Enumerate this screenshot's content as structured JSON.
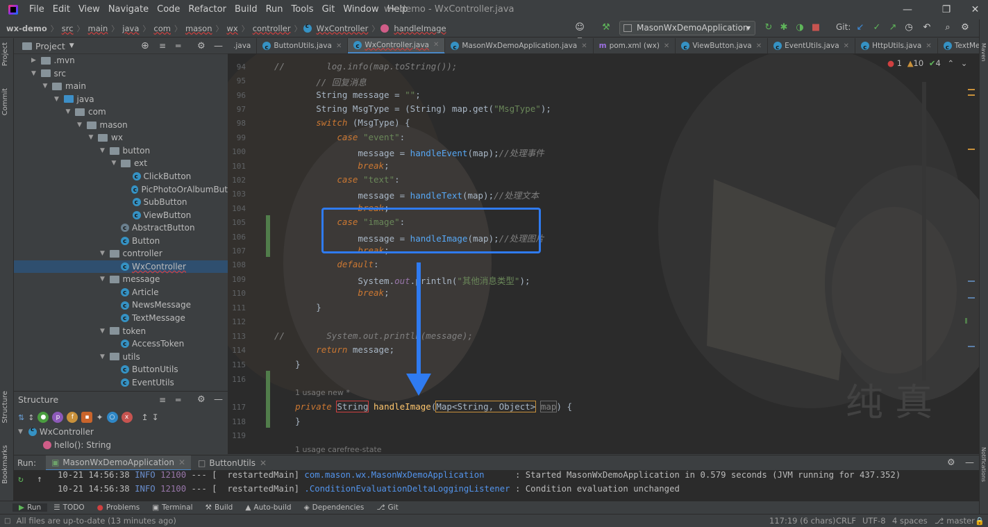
{
  "menu": [
    "File",
    "Edit",
    "View",
    "Navigate",
    "Code",
    "Refactor",
    "Build",
    "Run",
    "Tools",
    "Git",
    "Window",
    "Help"
  ],
  "window_title": "wx-demo - WxController.java",
  "breadcrumbs": [
    "wx-demo",
    "src",
    "main",
    "java",
    "com",
    "mason",
    "wx",
    "controller",
    "WxController",
    "handleImage"
  ],
  "toolbar": {
    "run_config": "MasonWxDemoApplication",
    "git_label": "Git:"
  },
  "project_panel": {
    "title": "Project"
  },
  "tree": [
    {
      "label": ".mvn",
      "depth": 1,
      "open": false
    },
    {
      "label": "src",
      "depth": 1,
      "open": true
    },
    {
      "label": "main",
      "depth": 2,
      "open": true
    },
    {
      "label": "java",
      "depth": 3,
      "open": true
    },
    {
      "label": "com",
      "depth": 4,
      "open": true
    },
    {
      "label": "mason",
      "depth": 5,
      "open": true
    },
    {
      "label": "wx",
      "depth": 6,
      "open": true
    },
    {
      "label": "button",
      "depth": 7,
      "open": true
    },
    {
      "label": "ext",
      "depth": 8,
      "open": true
    },
    {
      "label": "ClickButton",
      "depth": 9,
      "type": "class"
    },
    {
      "label": "PicPhotoOrAlbumBut",
      "depth": 9,
      "type": "class"
    },
    {
      "label": "SubButton",
      "depth": 9,
      "type": "class"
    },
    {
      "label": "ViewButton",
      "depth": 9,
      "type": "class"
    },
    {
      "label": "AbstractButton",
      "depth": 8,
      "type": "abstract"
    },
    {
      "label": "Button",
      "depth": 8,
      "type": "class"
    },
    {
      "label": "controller",
      "depth": 7,
      "open": true
    },
    {
      "label": "WxController",
      "depth": 8,
      "type": "class",
      "selected": true
    },
    {
      "label": "message",
      "depth": 7,
      "open": true
    },
    {
      "label": "Article",
      "depth": 8,
      "type": "class"
    },
    {
      "label": "NewsMessage",
      "depth": 8,
      "type": "class"
    },
    {
      "label": "TextMessage",
      "depth": 8,
      "type": "class"
    },
    {
      "label": "token",
      "depth": 7,
      "open": true
    },
    {
      "label": "AccessToken",
      "depth": 8,
      "type": "class"
    },
    {
      "label": "utils",
      "depth": 7,
      "open": true
    },
    {
      "label": "ButtonUtils",
      "depth": 8,
      "type": "class"
    },
    {
      "label": "EventUtils",
      "depth": 8,
      "type": "class"
    }
  ],
  "structure": {
    "title": "Structure",
    "root": "WxController",
    "child": "hello(): String"
  },
  "tabs": [
    ".java",
    "ButtonUtils.java",
    "WxController.java",
    "MasonWxDemoApplication.java",
    "pom.xml (wx)",
    "ViewButton.java",
    "EventUtils.java",
    "HttpUtils.java",
    "TextMessage.java"
  ],
  "inspection": {
    "errors": "1",
    "warnings": "10",
    "ok": "4"
  },
  "code_lines": [
    "94",
    "95",
    "96",
    "97",
    "98",
    "99",
    "100",
    "101",
    "102",
    "103",
    "104",
    "105",
    "106",
    "107",
    "108",
    "109",
    "110",
    "111",
    "112",
    "113",
    "114",
    "115",
    "116",
    "117",
    "118",
    "119"
  ],
  "inlays": {
    "usage1": "1 usage   new *",
    "usage2": "1 usage   carefree-state"
  },
  "run": {
    "label": "Run:",
    "tab1": "MasonWxDemoApplication",
    "tab2": "ButtonUtils"
  },
  "console": [
    {
      "time": "10-21 14:56:38",
      "level": "INFO",
      "pid": "12100",
      "sep": "--- [  restartedMain]",
      "logger": "com.mason.wx.MasonWxDemoApplication",
      "msg": "      : Started MasonWxDemoApplication in 0.579 seconds (JVM running for 437.352)"
    },
    {
      "time": "10-21 14:56:38",
      "level": "INFO",
      "pid": "12100",
      "sep": "--- [  restartedMain]",
      "logger": ".ConditionEvaluationDeltaLoggingListener",
      "msg": " : Condition evaluation unchanged"
    }
  ],
  "bottom_tabs": [
    "Run",
    "TODO",
    "Problems",
    "Terminal",
    "Build",
    "Auto-build",
    "Dependencies",
    "Git"
  ],
  "status": {
    "left": "All files are up-to-date (13 minutes ago)",
    "pos": "117:19 (6 chars)",
    "sep": "CRLF",
    "enc": "UTF-8",
    "indent": "4 spaces",
    "branch": "master"
  },
  "side_tabs": {
    "project": "Project",
    "commit": "Commit",
    "structure": "Structure",
    "bookmarks": "Bookmarks",
    "maven": "Maven",
    "notifications": "Notifications"
  },
  "watermark": "纯 真"
}
